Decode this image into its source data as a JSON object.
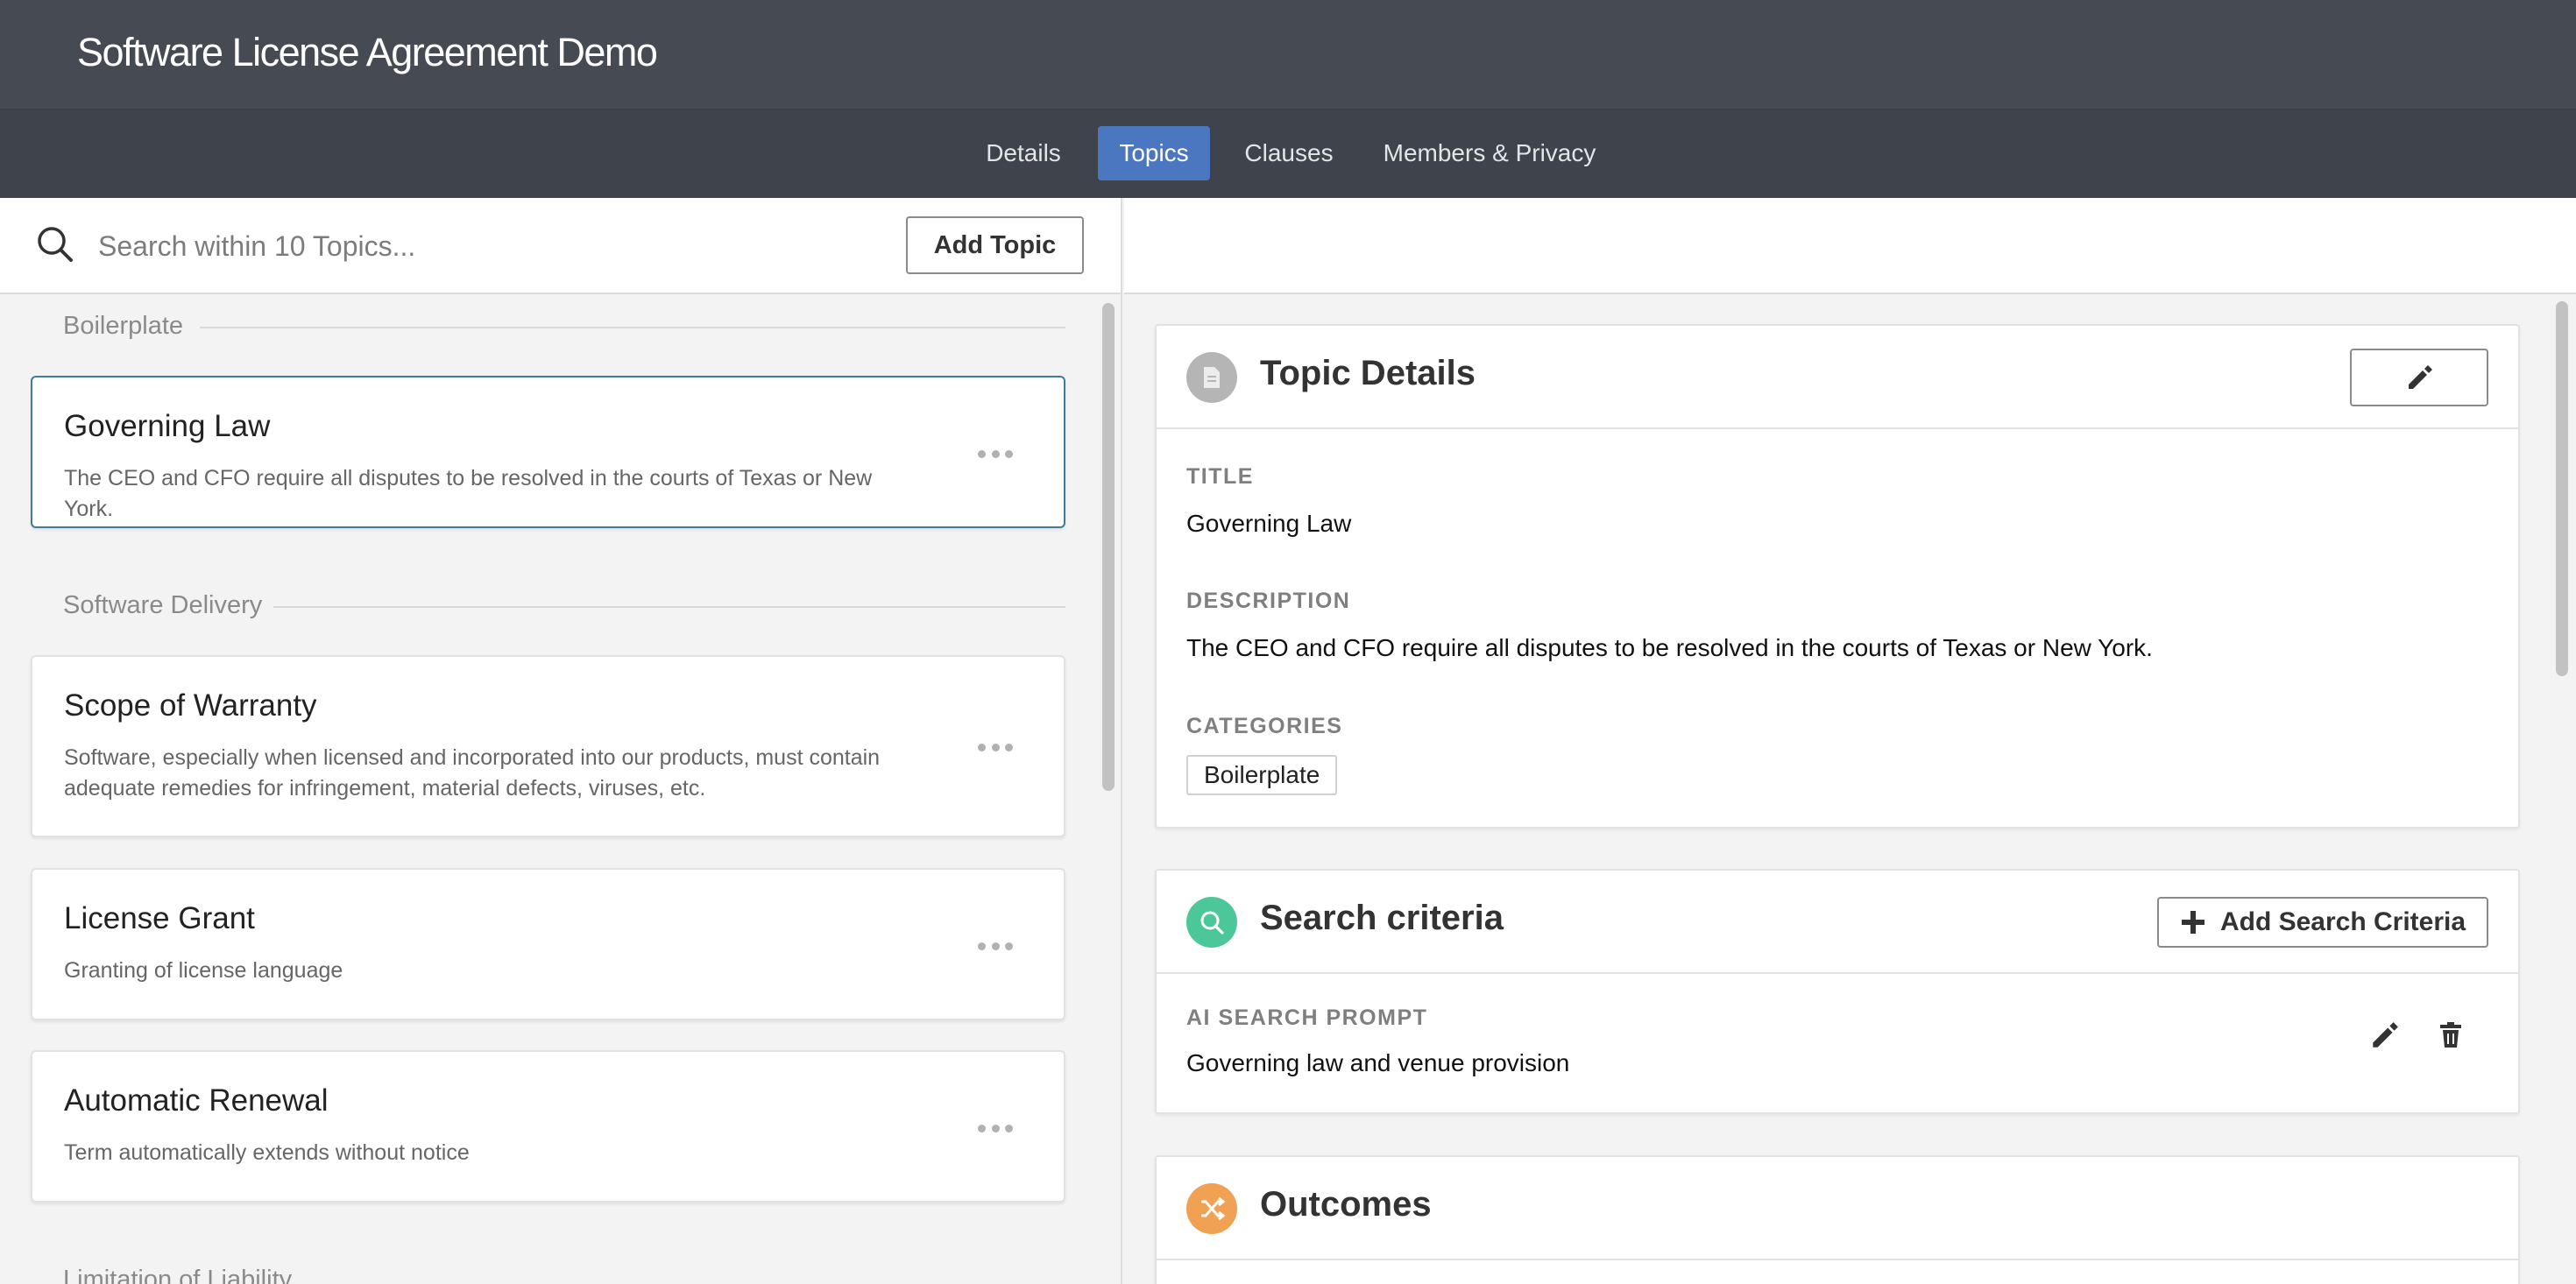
{
  "app": {
    "title": "Software License Agreement Demo"
  },
  "tabs": [
    {
      "label": "Details"
    },
    {
      "label": "Topics"
    },
    {
      "label": "Clauses"
    },
    {
      "label": "Members & Privacy"
    }
  ],
  "active_tab": "Topics",
  "search": {
    "placeholder": "Search within 10 Topics...",
    "value": ""
  },
  "toolbar": {
    "add_topic_label": "Add Topic"
  },
  "sections": [
    {
      "name": "Boilerplate"
    },
    {
      "name": "Software Delivery"
    },
    {
      "name": "Limitation of Liability"
    }
  ],
  "topics": [
    {
      "title": "Governing Law",
      "description": "The CEO and CFO require all disputes to be resolved in the courts of Texas or New York.",
      "section": "Boilerplate",
      "selected": true
    },
    {
      "title": "Scope of Warranty",
      "description": "Software, especially when licensed and incorporated into our products, must contain adequate remedies for infringement, material defects, viruses, etc.",
      "section": "Software Delivery"
    },
    {
      "title": "License Grant",
      "description": "Granting of license language",
      "section": "Software Delivery"
    },
    {
      "title": "Automatic Renewal",
      "description": "Term automatically extends without notice",
      "section": "Software Delivery"
    }
  ],
  "topic_details": {
    "heading": "Topic Details",
    "title_label": "TITLE",
    "title_value": "Governing Law",
    "description_label": "DESCRIPTION",
    "description_value": "The CEO and CFO require all disputes to be resolved in the courts of Texas or New York.",
    "categories_label": "CATEGORIES",
    "categories": [
      "Boilerplate"
    ]
  },
  "search_criteria": {
    "heading": "Search criteria",
    "add_label": "Add Search Criteria",
    "prompt_label": "AI SEARCH PROMPT",
    "prompt_value": "Governing law and venue provision"
  },
  "outcomes": {
    "heading": "Outcomes"
  },
  "colors": {
    "header_bg": "#464a53",
    "tabbar_bg": "#3f434b",
    "active_tab": "#4b77c1",
    "selected_border": "#3f7c95",
    "details_icon": "#b5b5b5",
    "search_icon": "#4cc79a",
    "outcomes_icon": "#f0a154"
  },
  "icons": [
    "search-icon",
    "more-icon",
    "document-icon",
    "pencil-icon",
    "magnifier-icon",
    "plus-icon",
    "trash-icon",
    "shuffle-icon"
  ]
}
